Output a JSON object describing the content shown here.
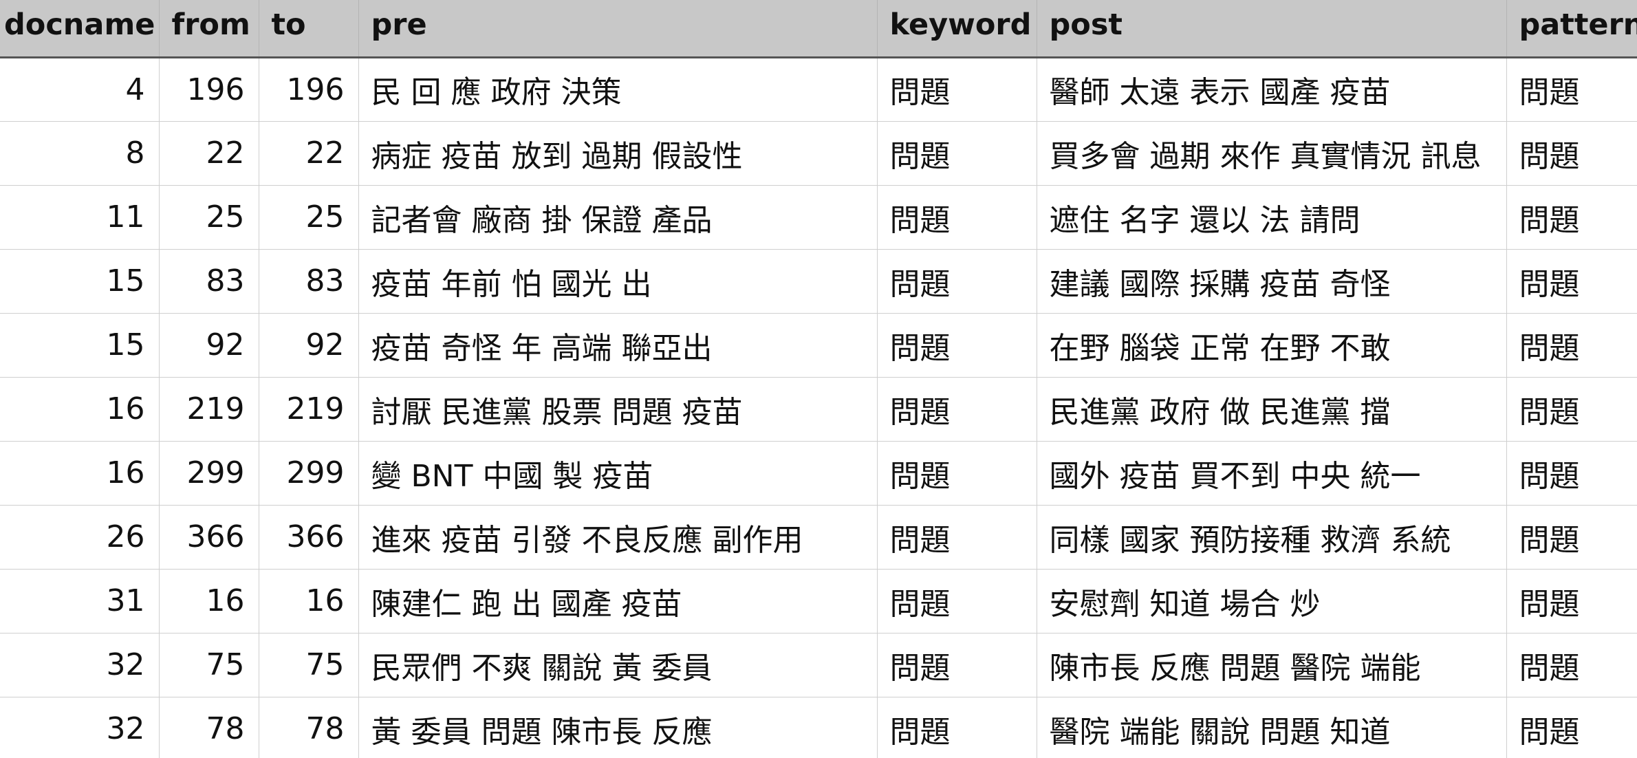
{
  "table": {
    "columns": [
      "docname",
      "from",
      "to",
      "pre",
      "keyword",
      "post",
      "pattern"
    ],
    "rows": [
      {
        "docname": "4",
        "from": "196",
        "to": "196",
        "pre": "民 回 應 政府 決策",
        "keyword": "問題",
        "post": "醫師 太遠 表示 國產 疫苗",
        "pattern": "問題"
      },
      {
        "docname": "8",
        "from": "22",
        "to": "22",
        "pre": "病症 疫苗 放到 過期 假設性",
        "keyword": "問題",
        "post": "買多會 過期 來作 真實情況 訊息",
        "pattern": "問題"
      },
      {
        "docname": "11",
        "from": "25",
        "to": "25",
        "pre": "記者會 廠商 掛 保證 產品",
        "keyword": "問題",
        "post": "遮住 名字 還以 法 請問",
        "pattern": "問題"
      },
      {
        "docname": "15",
        "from": "83",
        "to": "83",
        "pre": "疫苗 年前 怕 國光 出",
        "keyword": "問題",
        "post": "建議 國際 採購 疫苗 奇怪",
        "pattern": "問題"
      },
      {
        "docname": "15",
        "from": "92",
        "to": "92",
        "pre": "疫苗 奇怪 年 高端 聯亞出",
        "keyword": "問題",
        "post": "在野 腦袋 正常 在野 不敢",
        "pattern": "問題"
      },
      {
        "docname": "16",
        "from": "219",
        "to": "219",
        "pre": "討厭 民進黨 股票 問題 疫苗",
        "keyword": "問題",
        "post": "民進黨 政府 做 民進黨 擋",
        "pattern": "問題"
      },
      {
        "docname": "16",
        "from": "299",
        "to": "299",
        "pre": "變 BNT 中國 製 疫苗",
        "keyword": "問題",
        "post": "國外 疫苗 買不到 中央 統一",
        "pattern": "問題"
      },
      {
        "docname": "26",
        "from": "366",
        "to": "366",
        "pre": "進來 疫苗 引發 不良反應 副作用",
        "keyword": "問題",
        "post": "同樣 國家 預防接種 救濟 系統",
        "pattern": "問題"
      },
      {
        "docname": "31",
        "from": "16",
        "to": "16",
        "pre": "陳建仁 跑 出 國產 疫苗",
        "keyword": "問題",
        "post": "安慰劑 知道 場合 炒",
        "pattern": "問題"
      },
      {
        "docname": "32",
        "from": "75",
        "to": "75",
        "pre": "民眾們 不爽 關說 黃 委員",
        "keyword": "問題",
        "post": "陳市長 反應 問題 醫院 端能",
        "pattern": "問題"
      },
      {
        "docname": "32",
        "from": "78",
        "to": "78",
        "pre": "黃 委員 問題 陳市長 反應",
        "keyword": "問題",
        "post": "醫院 端能 關說 問題 知道",
        "pattern": "問題"
      }
    ]
  }
}
